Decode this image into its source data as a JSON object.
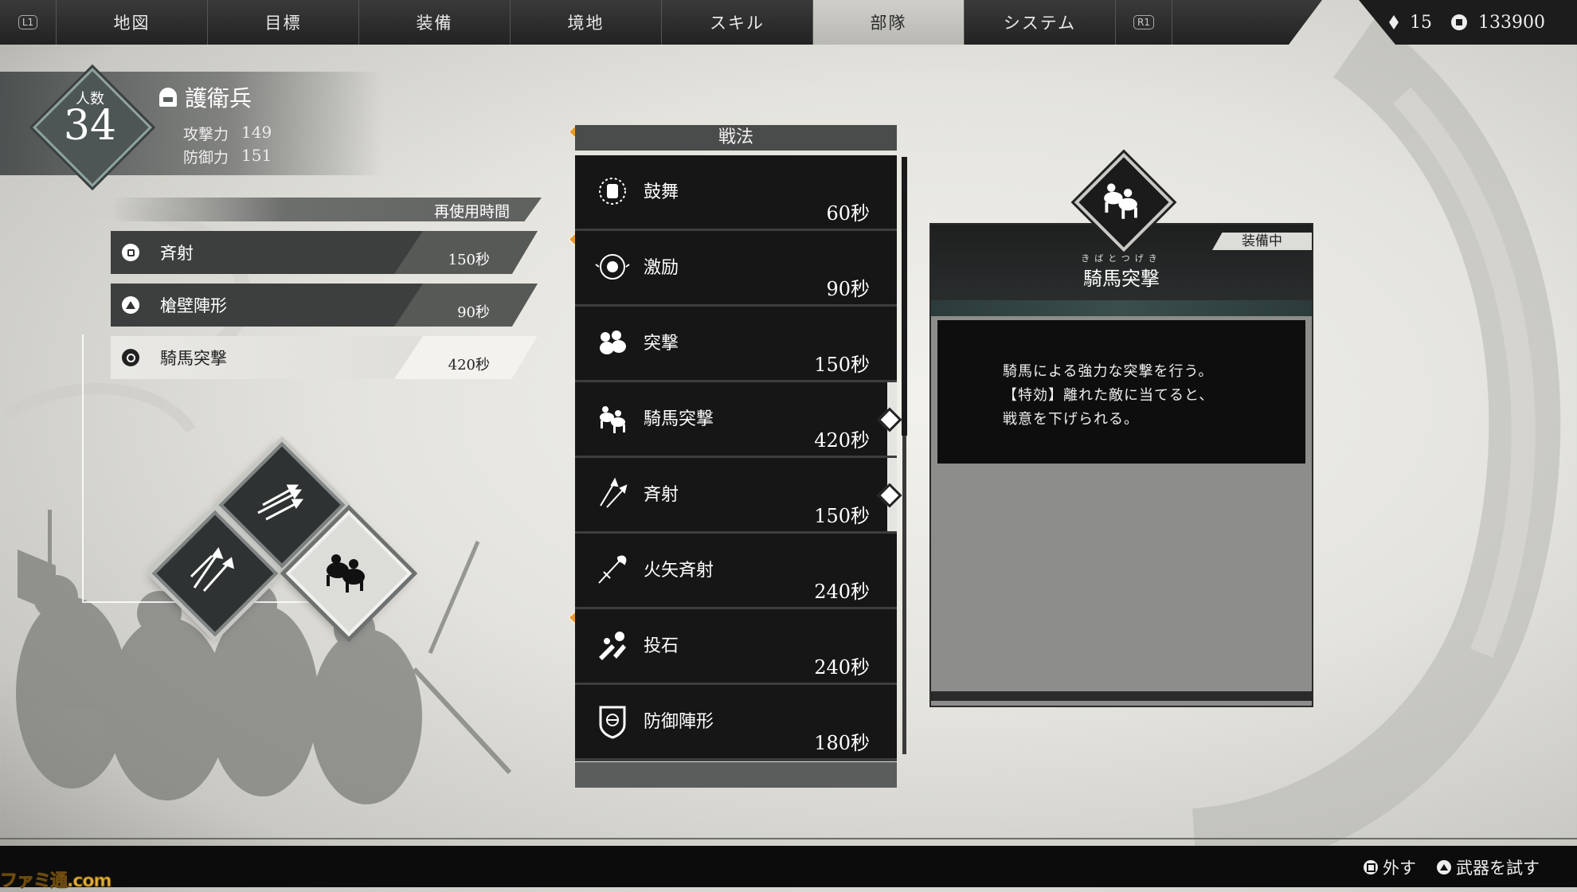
{
  "nav": {
    "left_button": "L1",
    "right_button": "R1",
    "tabs": [
      "地図",
      "目標",
      "装備",
      "境地",
      "スキル",
      "部隊",
      "システム"
    ],
    "active_tab": "部隊"
  },
  "currency": {
    "gems": "15",
    "money": "133900"
  },
  "unit": {
    "count_label": "人数",
    "count": "34",
    "name": "護衛兵",
    "stats": [
      {
        "label": "攻撃力",
        "value": "149"
      },
      {
        "label": "防御力",
        "value": "151"
      }
    ]
  },
  "equipped": {
    "header": "再使用時間",
    "slots": [
      {
        "button": "square-button",
        "name": "斉射",
        "time": "150秒",
        "selected": false
      },
      {
        "button": "triangle-button",
        "name": "槍壁陣形",
        "time": "90秒",
        "selected": false
      },
      {
        "button": "circle-button",
        "name": "騎馬突撃",
        "time": "420秒",
        "selected": true
      }
    ]
  },
  "tactics": {
    "header": "戦法",
    "items": [
      {
        "icon": "fist-icon",
        "name": "鼓舞",
        "time": "60秒",
        "equipped": false
      },
      {
        "icon": "rally-icon",
        "name": "激励",
        "time": "90秒",
        "equipped": false
      },
      {
        "icon": "charge-icon",
        "name": "突撃",
        "time": "150秒",
        "equipped": false
      },
      {
        "icon": "cavalry-icon",
        "name": "騎馬突撃",
        "time": "420秒",
        "equipped": true
      },
      {
        "icon": "arrows-icon",
        "name": "斉射",
        "time": "150秒",
        "equipped": true
      },
      {
        "icon": "fire-arrow-icon",
        "name": "火矢斉射",
        "time": "240秒",
        "equipped": false
      },
      {
        "icon": "stone-throw-icon",
        "name": "投石",
        "time": "240秒",
        "equipped": false
      },
      {
        "icon": "shield-icon",
        "name": "防御陣形",
        "time": "180秒",
        "equipped": false
      }
    ]
  },
  "detail": {
    "equipped_tag": "装備中",
    "ruby": "きばとつげき",
    "title": "騎馬突撃",
    "icon": "cavalry-icon",
    "description": [
      "騎馬による強力な突撃を行う。",
      "【特効】離れた敵に当てると、",
      "戦意を下げられる。"
    ]
  },
  "hints": [
    {
      "button": "square-button",
      "label": "外す"
    },
    {
      "button": "triangle-button",
      "label": "武器を試す"
    }
  ],
  "watermark": "ファミ通.com",
  "colors": {
    "accent_orange": "#e99b2a",
    "panel_dark": "#161616",
    "teal": "#4d5555"
  }
}
